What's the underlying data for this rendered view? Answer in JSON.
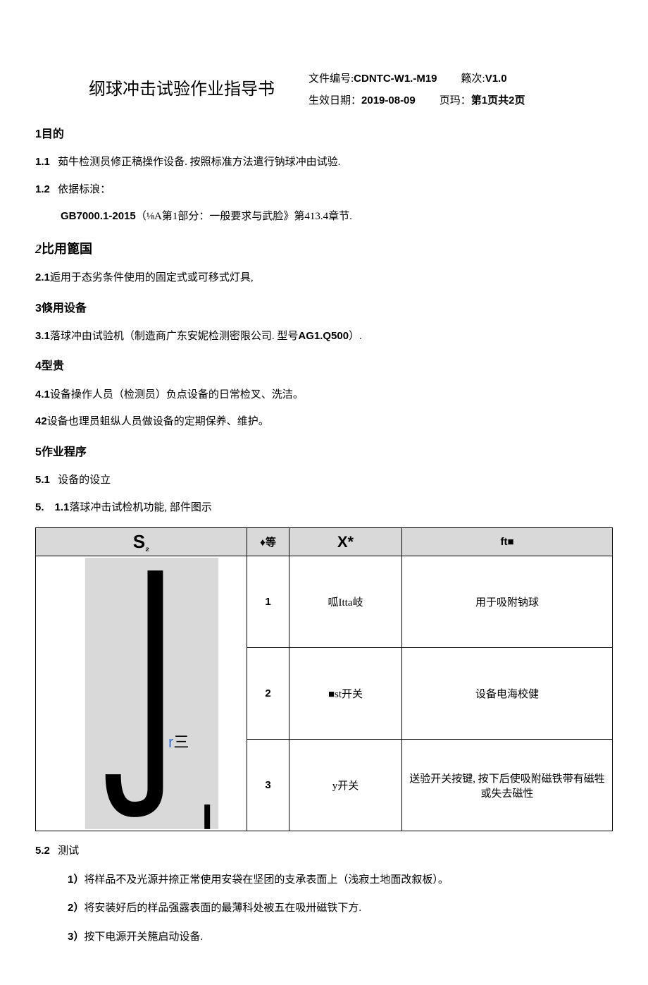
{
  "header": {
    "title": "纲球冲击试验作业指导书",
    "doc_no_label": "文件编号:",
    "doc_no": "CDNTC-W1.-M19",
    "version_label": "籁次:",
    "version": "V1.0",
    "date_label": "生效日期：",
    "date": "2019-08-09",
    "page_label": "页玛：",
    "page": "第1页共2页"
  },
  "s1": {
    "heading_num": "1",
    "heading_text": "目的",
    "i1_label": "1.1",
    "i1_text": "茹牛检测员修正稿操作设备. 按照标准方法遣行钠球冲由试验.",
    "i2_label": "1.2",
    "i2_text": "依据标浪：",
    "i2_sub_bold": "GB7000.1-2015",
    "i2_sub_rest": "（⅛A第1部分：一般要求与武脸》第413.4章节."
  },
  "s2": {
    "heading_num": "2",
    "heading_text": "比用篦国",
    "i1_label": "2.1",
    "i1_text": "逅用于态劣条件使用的固定式或可移式灯具,"
  },
  "s3": {
    "heading_num": "3",
    "heading_text": "倏用设备",
    "i1_label": "3.1",
    "i1_text_a": "落球冲由试验机（制造商广东安妮检测密限公司. 型号",
    "i1_text_model": "AG1.Q500",
    "i1_text_b": "）."
  },
  "s4": {
    "heading_num": "4",
    "heading_text": "型贵",
    "i1_label": "4.1",
    "i1_text": "设备操作人员（检测员）负点设备的日常检叉、洗洁。",
    "i2_label": "42",
    "i2_text": "设备也理员蛆纵人员做设备的定期保养、维护。"
  },
  "s5": {
    "heading_num": "5",
    "heading_text": "作业程序",
    "i1_label": "5.1",
    "i1_text": "设备的设立",
    "i11_label": "5.　1.1",
    "i11_text": "落球冲击试检机功能, 部件图示"
  },
  "table": {
    "th_img": "S",
    "th_img_sub": "₂",
    "th_num": "♦等",
    "th_name": "X*",
    "th_desc": "ft■",
    "fig_r_label": "r",
    "fig_r_glyph": "三",
    "rows": [
      {
        "num": "1",
        "name": "呱Itta岐",
        "desc": "用于吸附钠球"
      },
      {
        "num": "2",
        "name": "■st开关",
        "desc": "设备电海校健"
      },
      {
        "num": "3",
        "name": "y开关",
        "desc": "送验开关按键, 按下后使吸附磁铁带有磁牲或失去磁性"
      }
    ]
  },
  "s52": {
    "label": "5.2",
    "text": "测试",
    "steps": [
      {
        "num": "1）",
        "text": "将样品不及光源并捺正常使用安袋在坚团的支承表面上（浅寂土地面改叙板）。"
      },
      {
        "num": "2）",
        "text": "将安装好后的样品强露表面的最薄科处被五在吸卅磁铁下方."
      },
      {
        "num": "3）",
        "text": "按下电源开关箷启动设备."
      }
    ]
  }
}
